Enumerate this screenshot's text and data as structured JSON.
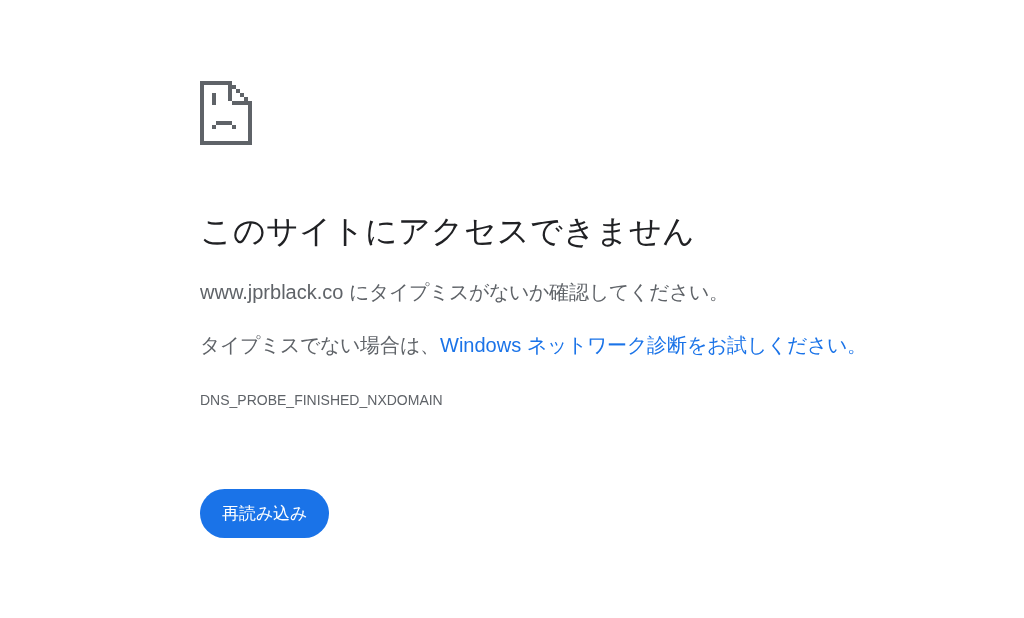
{
  "error_page": {
    "title": "このサイトにアクセスできません",
    "message": "www.jprblack.co にタイプミスがないか確認してください。",
    "suggestion": {
      "text": "タイプミスでない場合は、",
      "link": "Windows ネットワーク診断をお試しください。"
    },
    "error_code": "DNS_PROBE_FINISHED_NXDOMAIN",
    "button": "再読み込み"
  }
}
